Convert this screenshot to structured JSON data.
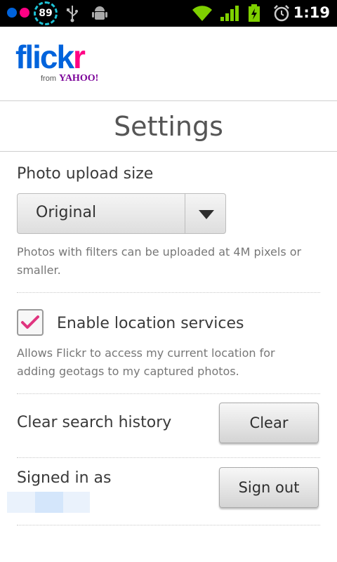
{
  "status_bar": {
    "battery_percent": "89",
    "time": "1:19",
    "icons": [
      "notification-dots",
      "battery-ring",
      "usb-icon",
      "android-debug-icon",
      "wifi-icon",
      "signal-icon",
      "battery-icon",
      "alarm-icon"
    ]
  },
  "header": {
    "logo_part1": "flick",
    "logo_part2": "r",
    "logo_sub_from": "from",
    "logo_sub_brand": "YAHOO!"
  },
  "page": {
    "title": "Settings"
  },
  "settings": {
    "upload": {
      "label": "Photo upload size",
      "selected": "Original",
      "description": "Photos with filters can be uploaded at 4M pixels or smaller."
    },
    "location": {
      "label": "Enable location services",
      "checked": true,
      "description": "Allows Flickr to access my current location for adding geotags to my captured photos."
    },
    "search_history": {
      "label": "Clear search history",
      "button": "Clear"
    },
    "account": {
      "label": "Signed in as",
      "button": "Sign out"
    }
  },
  "colors": {
    "flickr_blue": "#0063dc",
    "flickr_pink": "#ff0084",
    "checkmark": "#e0357f"
  }
}
